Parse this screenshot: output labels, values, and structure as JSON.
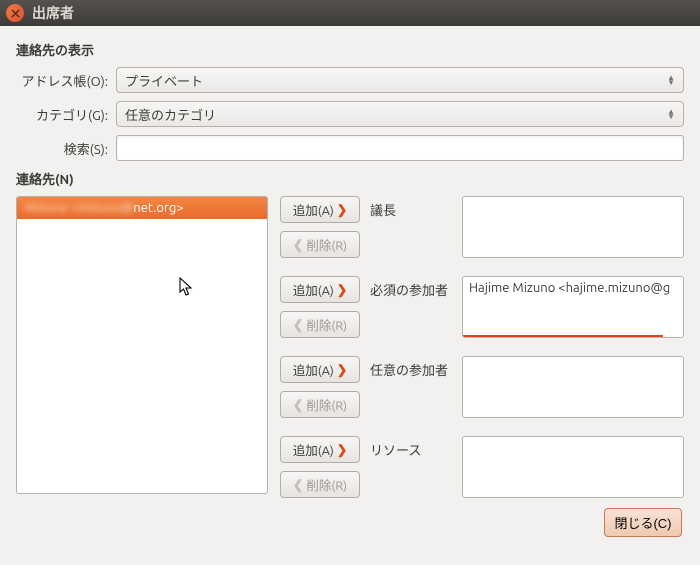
{
  "window": {
    "title": "出席者"
  },
  "sections": {
    "contact_display": "連絡先の表示",
    "contacts": "連絡先(N)"
  },
  "labels": {
    "address_book": "アドレス帳(O):",
    "category": "カテゴリ(G):",
    "search": "検索(S):"
  },
  "combos": {
    "address_book": "プライベート",
    "category": "任意のカテゴリ"
  },
  "search_value": "",
  "contact_list": {
    "items": [
      {
        "blurred_prefix": "Mizuno <mizuno@",
        "suffix": "net.org>"
      }
    ]
  },
  "roles": {
    "chair": {
      "label": "議長",
      "value": ""
    },
    "required": {
      "label": "必須の参加者",
      "value": "Hajime Mizuno <hajime.mizuno@g"
    },
    "optional": {
      "label": "任意の参加者",
      "value": ""
    },
    "resource": {
      "label": "リソース",
      "value": ""
    }
  },
  "buttons": {
    "add": "追加(A)",
    "del": "削除(R)",
    "close": "閉じる(C)"
  }
}
